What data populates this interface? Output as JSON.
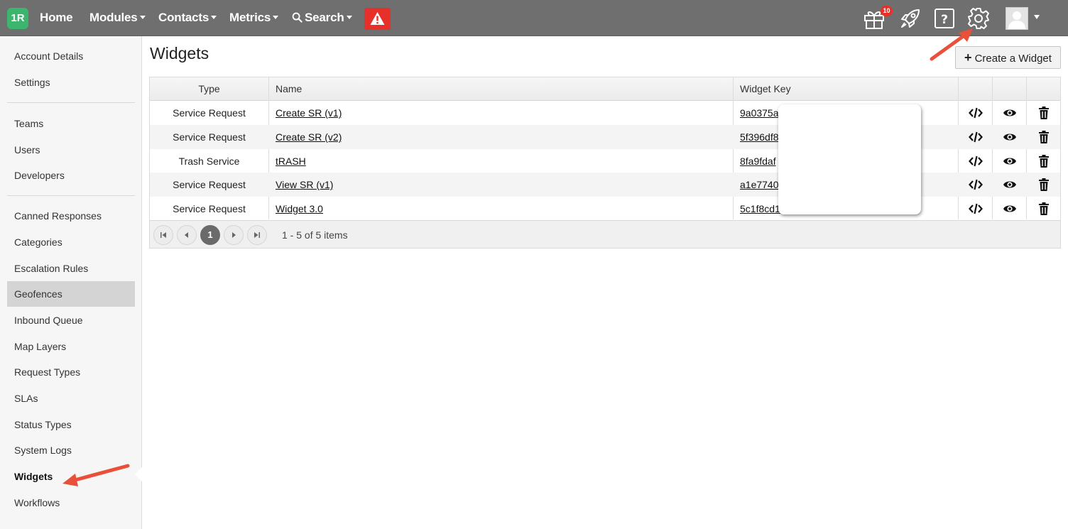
{
  "nav": {
    "logo": "1R",
    "home": "Home",
    "modules": "Modules",
    "contacts": "Contacts",
    "metrics": "Metrics",
    "search": "Search",
    "gift_badge": "10"
  },
  "sidebar": {
    "items": [
      "Account Details",
      "Settings",
      "Teams",
      "Users",
      "Developers",
      "Canned Responses",
      "Categories",
      "Escalation Rules",
      "Geofences",
      "Inbound Queue",
      "Map Layers",
      "Request Types",
      "SLAs",
      "Status Types",
      "System Logs",
      "Widgets",
      "Workflows"
    ]
  },
  "page": {
    "title": "Widgets",
    "create_button": "Create a Widget"
  },
  "table": {
    "headers": {
      "type": "Type",
      "name": "Name",
      "key": "Widget Key"
    },
    "rows": [
      {
        "type": "Service Request",
        "name": "Create SR (v1)",
        "key": "9a0375a"
      },
      {
        "type": "Service Request",
        "name": "Create SR (v2)",
        "key": "5f396df8"
      },
      {
        "type": "Trash Service",
        "name": "tRASH",
        "key": "8fa9fdaf"
      },
      {
        "type": "Service Request",
        "name": "View SR (v1)",
        "key": "a1e7740"
      },
      {
        "type": "Service Request",
        "name": "Widget 3.0",
        "key": "5c1f8cd1"
      }
    ],
    "pager": {
      "current": "1",
      "info": "1 - 5 of 5 items"
    }
  },
  "colors": {
    "topbar": "#6f6f6f",
    "logo": "#3cb56f",
    "alert": "#e8302a",
    "arrow": "#e8503a"
  },
  "icons": [
    "gift-icon",
    "rocket-icon",
    "help-icon",
    "gear-icon",
    "user-avatar-icon",
    "warning-icon",
    "code-icon",
    "eye-icon",
    "trash-icon"
  ]
}
